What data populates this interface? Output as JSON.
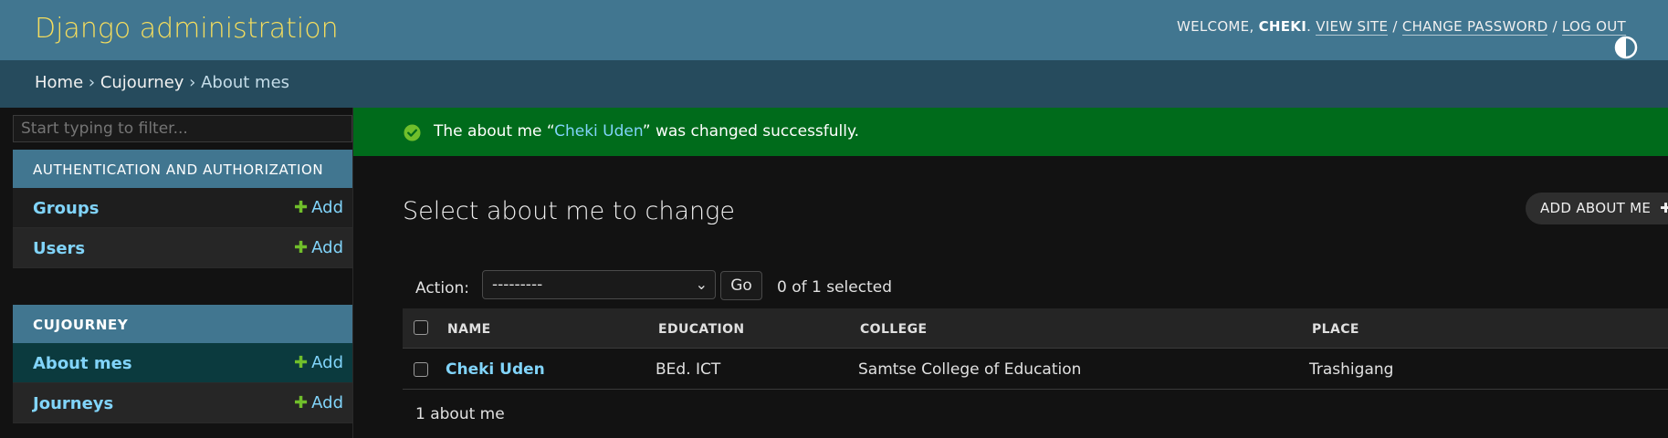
{
  "header": {
    "branding": "Django administration",
    "welcome_text": "WELCOME, ",
    "username": "CHEKI",
    "view_site": "VIEW SITE",
    "change_password": "CHANGE PASSWORD",
    "log_out": "LOG OUT",
    "separator": " / "
  },
  "breadcrumbs": {
    "home": "Home",
    "app": "Cujourney",
    "current": "About mes",
    "sep": " › "
  },
  "sidebar": {
    "filter_placeholder": "Start typing to filter...",
    "apps": [
      {
        "caption": "Authentication and Authorization",
        "models": [
          {
            "name": "Groups",
            "add_label": "Add"
          },
          {
            "name": "Users",
            "add_label": "Add"
          }
        ]
      },
      {
        "caption": "Cujourney",
        "models": [
          {
            "name": "About mes",
            "add_label": "Add"
          },
          {
            "name": "Journeys",
            "add_label": "Add"
          }
        ]
      }
    ]
  },
  "message": {
    "prefix": "The about me “",
    "link": "Cheki Uden",
    "suffix": "” was changed successfully."
  },
  "main": {
    "title": "Select about me to change",
    "add_button": "ADD ABOUT ME",
    "action_label": "Action:",
    "action_selected": "---------",
    "go_label": "Go",
    "selected_count": "0 of 1 selected",
    "columns": [
      "Name",
      "Education",
      "College",
      "Place"
    ],
    "rows": [
      {
        "name": "Cheki Uden",
        "education": "BEd. ICT",
        "college": "Samtse College of Education",
        "place": "Trashigang"
      }
    ],
    "paginator": "1 about me"
  },
  "colors": {
    "header_bg": "#417690",
    "breadcrumb_bg": "#264b5d",
    "branding": "#f5dd5d",
    "link": "#81d4fa",
    "success_bg": "#006b1b",
    "add_plus": "#70bf2b"
  }
}
